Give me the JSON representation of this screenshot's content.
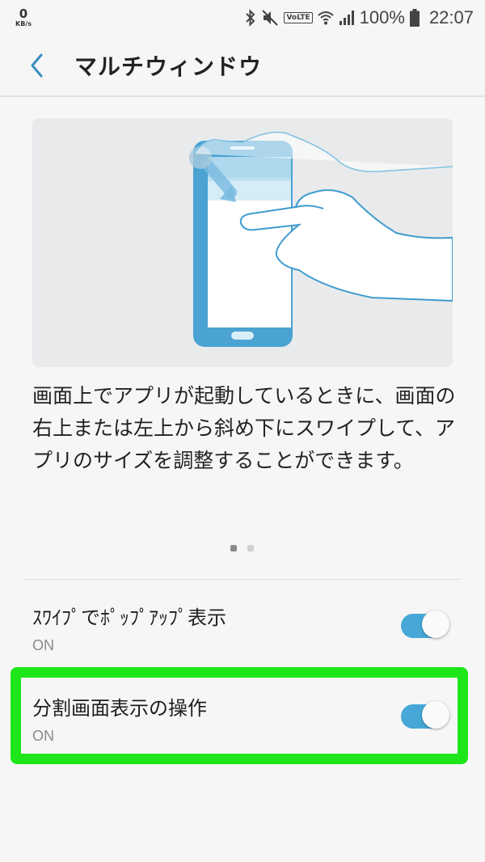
{
  "status_bar": {
    "net_speed_value": "0",
    "net_speed_unit": "KB/s",
    "volte": "VoLTE",
    "battery_percent": "100%",
    "time": "22:07"
  },
  "app_bar": {
    "title": "マルチウィンドウ"
  },
  "description": "画面上でアプリが起動しているときに、画面の右上または左上から斜め下にスワイプして、アプリのサイズを調整することができます。",
  "pager": {
    "current": 1,
    "total": 2
  },
  "settings": [
    {
      "label": "ｽﾜｲﾌﾟでﾎﾟｯﾌﾟｱｯﾌﾟ表示",
      "status": "ON",
      "enabled": true
    },
    {
      "label": "分割画面表示の操作",
      "status": "ON",
      "enabled": true
    }
  ],
  "colors": {
    "accent": "#47a8d8",
    "highlight": "#1ee61a",
    "background": "#f6f6f6"
  },
  "icons": [
    "bluetooth-icon",
    "mute-icon",
    "wifi-icon",
    "signal-icon",
    "battery-icon",
    "back-arrow-icon"
  ]
}
